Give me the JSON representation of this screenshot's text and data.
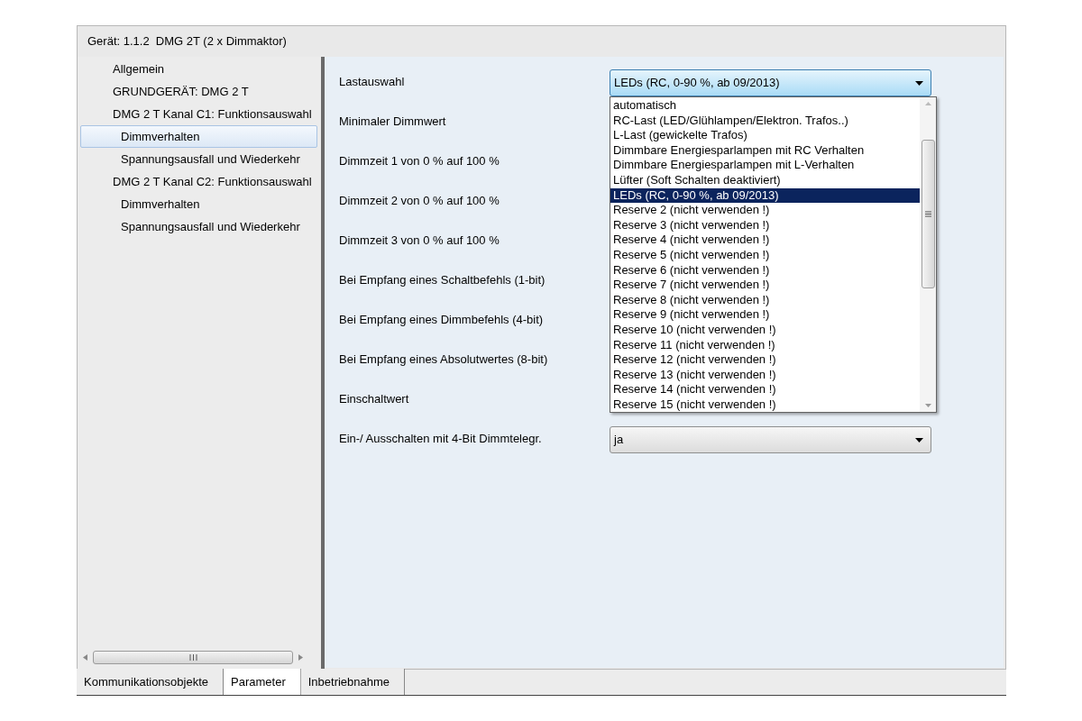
{
  "device_title": "Gerät: 1.1.2  DMG 2T (2 x Dimmaktor)",
  "sidebar": {
    "items": [
      {
        "label": "Allgemein",
        "selected": false
      },
      {
        "label": "GRUNDGERÄT: DMG 2 T",
        "selected": false
      },
      {
        "label": "DMG 2 T Kanal C1: Funktionsauswahl",
        "selected": false,
        "children": [
          {
            "label": "Dimmverhalten",
            "selected": true
          },
          {
            "label": "Spannungsausfall und Wiederkehr",
            "selected": false
          }
        ]
      },
      {
        "label": "DMG 2 T Kanal C2: Funktionsauswahl",
        "selected": false,
        "children": [
          {
            "label": "Dimmverhalten",
            "selected": false
          },
          {
            "label": "Spannungsausfall und Wiederkehr",
            "selected": false
          }
        ]
      }
    ]
  },
  "parameters": [
    {
      "label": "Lastauswahl",
      "value": "LEDs (RC, 0-90 %, ab 09/2013)",
      "open": true
    },
    {
      "label": "Minimaler Dimmwert"
    },
    {
      "label": "Dimmzeit 1 von 0 % auf 100 %"
    },
    {
      "label": "Dimmzeit 2 von 0 % auf 100 %"
    },
    {
      "label": "Dimmzeit 3 von 0 % auf 100 %"
    },
    {
      "label": "Bei Empfang eines Schaltbefehls (1-bit)"
    },
    {
      "label": "Bei Empfang eines Dimmbefehls (4-bit)"
    },
    {
      "label": "Bei Empfang eines Absolutwertes (8-bit)"
    },
    {
      "label": "Einschaltwert"
    },
    {
      "label": "Ein-/ Ausschalten mit 4-Bit Dimmtelegr.",
      "value": "ja",
      "open": false
    }
  ],
  "dropdown_list": {
    "items": [
      {
        "label": "automatisch",
        "selected": false
      },
      {
        "label": "RC-Last (LED/Glühlampen/Elektron. Trafos..)",
        "selected": false
      },
      {
        "label": "L-Last (gewickelte Trafos)",
        "selected": false
      },
      {
        "label": "Dimmbare Energiesparlampen mit RC Verhalten",
        "selected": false
      },
      {
        "label": "Dimmbare Energiesparlampen mit L-Verhalten",
        "selected": false
      },
      {
        "label": "Lüfter (Soft Schalten deaktiviert)",
        "selected": false
      },
      {
        "label": "LEDs (RC, 0-90 %, ab 09/2013)",
        "selected": true
      },
      {
        "label": "Reserve 2 (nicht verwenden !)",
        "selected": false
      },
      {
        "label": "Reserve 3 (nicht verwenden !)",
        "selected": false
      },
      {
        "label": "Reserve 4 (nicht verwenden !)",
        "selected": false
      },
      {
        "label": "Reserve 5 (nicht verwenden !)",
        "selected": false
      },
      {
        "label": "Reserve 6 (nicht verwenden !)",
        "selected": false
      },
      {
        "label": "Reserve 7 (nicht verwenden !)",
        "selected": false
      },
      {
        "label": "Reserve 8 (nicht verwenden !)",
        "selected": false
      },
      {
        "label": "Reserve 9 (nicht verwenden !)",
        "selected": false
      },
      {
        "label": "Reserve 10 (nicht verwenden !)",
        "selected": false
      },
      {
        "label": "Reserve 11 (nicht verwenden !)",
        "selected": false
      },
      {
        "label": "Reserve 12 (nicht verwenden !)",
        "selected": false
      },
      {
        "label": "Reserve 13 (nicht verwenden !)",
        "selected": false
      },
      {
        "label": "Reserve 14 (nicht verwenden !)",
        "selected": false
      },
      {
        "label": "Reserve 15 (nicht verwenden !)",
        "selected": false
      }
    ]
  },
  "tabs": [
    {
      "label": "Kommunikationsobjekte",
      "selected": false
    },
    {
      "label": "Parameter",
      "selected": true
    },
    {
      "label": "Inbetriebnahme",
      "selected": false
    }
  ]
}
